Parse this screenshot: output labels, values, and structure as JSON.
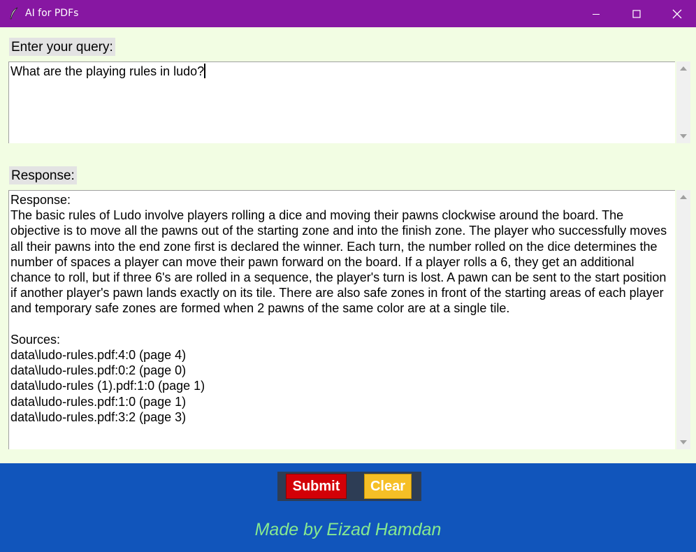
{
  "window": {
    "title": "AI for PDFs",
    "titlebar_color": "#8717a2",
    "icons": {
      "app": "feather-icon",
      "minimize": "minimize-icon",
      "maximize": "maximize-icon",
      "close": "close-icon"
    }
  },
  "query": {
    "label": "Enter your query:",
    "value": "What are the playing rules in ludo?"
  },
  "response": {
    "label": "Response:",
    "value": "Response:\nThe basic rules of Ludo involve players rolling a dice and moving their pawns clockwise around the board. The objective is to move all the pawns out of the starting zone and into the finish zone. The player who successfully moves all their pawns into the end zone first is declared the winner. Each turn, the number rolled on the dice determines the number of spaces a player can move their pawn forward on the board. If a player rolls a 6, they get an additional chance to roll, but if three 6's are rolled in a sequence, the player's turn is lost. A pawn can be sent to the start position if another player's pawn lands exactly on its tile. There are also safe zones in front of the starting areas of each player and temporary safe zones are formed when 2 pawns of the same color are at a single tile.\n\nSources:\ndata\\ludo-rules.pdf:4:0 (page 4)\ndata\\ludo-rules.pdf:0:2 (page 0)\ndata\\ludo-rules (1).pdf:1:0 (page 1)\ndata\\ludo-rules.pdf:1:0 (page 1)\ndata\\ludo-rules.pdf:3:2 (page 3)"
  },
  "buttons": {
    "submit": "Submit",
    "clear": "Clear"
  },
  "footer": {
    "credit": "Made by Eizad Hamdan",
    "background": "#1155bb",
    "credit_color": "#86e990"
  },
  "colors": {
    "background": "#f2fde3",
    "submit": "#d30007",
    "clear": "#f6bf26"
  }
}
